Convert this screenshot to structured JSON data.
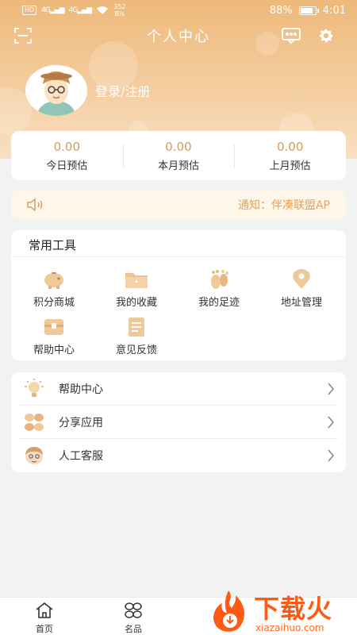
{
  "status_bar": {
    "network_badge": "HD",
    "signal_1": "4G",
    "signal_2": "4G",
    "net_speed_value": "352",
    "net_speed_unit": "B/s",
    "battery_percent": "88%",
    "battery_level": 0.88,
    "time": "4:01"
  },
  "header": {
    "title": "个人中心",
    "scan_icon": "scan-icon",
    "message_icon": "message-icon",
    "settings_icon": "gear-icon"
  },
  "profile": {
    "login_label": "登录/注册",
    "avatar_icon": "avatar-icon"
  },
  "stats": [
    {
      "value": "0.00",
      "label": "今日预估"
    },
    {
      "value": "0.00",
      "label": "本月预估"
    },
    {
      "value": "0.00",
      "label": "上月预估"
    }
  ],
  "notice": {
    "icon": "speaker-icon",
    "text": "通知：伴凑联盟AP"
  },
  "tools": {
    "title": "常用工具",
    "items": [
      {
        "label": "积分商城",
        "icon": "piggy-bank-icon"
      },
      {
        "label": "我的收藏",
        "icon": "folder-icon"
      },
      {
        "label": "我的足迹",
        "icon": "footprint-icon"
      },
      {
        "label": "地址管理",
        "icon": "location-pin-icon"
      },
      {
        "label": "帮助中心",
        "icon": "help-box-icon"
      },
      {
        "label": "意见反馈",
        "icon": "feedback-icon"
      }
    ]
  },
  "menu": [
    {
      "label": "帮助中心",
      "icon": "lightbulb-icon"
    },
    {
      "label": "分享应用",
      "icon": "share-grid-icon"
    },
    {
      "label": "人工客服",
      "icon": "customer-service-icon"
    }
  ],
  "tabbar": [
    {
      "label": "首页",
      "icon": "home-icon"
    },
    {
      "label": "名品",
      "icon": "brand-grid-icon"
    }
  ],
  "watermark": {
    "text": "下载火",
    "sub": "xiazaihuo.com"
  },
  "colors": {
    "header_top": "#eeb97a",
    "header_bottom": "#f8e0c2",
    "accent": "#d79a5c",
    "notice_text": "#e2a35c",
    "notice_bg": "#fdf6e9",
    "watermark": "#ff5a13"
  }
}
